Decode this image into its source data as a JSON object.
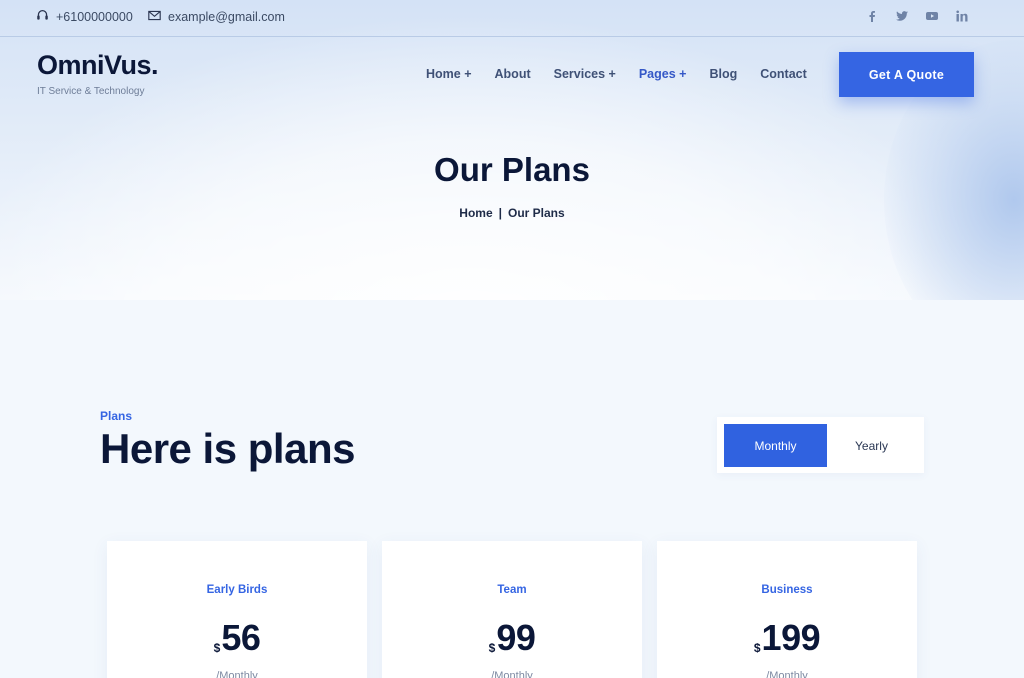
{
  "topbar": {
    "phone": "+6100000000",
    "email": "example@gmail.com",
    "socials": [
      "facebook-icon",
      "twitter-icon",
      "youtube-icon",
      "linkedin-icon"
    ]
  },
  "header": {
    "logo": "OmniVus.",
    "tagline": "IT Service & Technology",
    "nav": [
      "Home +",
      "About",
      "Services +",
      "Pages +",
      "Blog",
      "Contact"
    ],
    "active_nav": "Pages +",
    "cta": "Get A Quote"
  },
  "hero": {
    "title": "Our Plans",
    "breadcrumb_home": "Home",
    "breadcrumb_sep": "|",
    "breadcrumb_current": "Our Plans"
  },
  "plans": {
    "eyebrow": "Plans",
    "heading": "Here is plans",
    "toggle": {
      "monthly": "Monthly",
      "yearly": "Yearly",
      "selected": "Monthly"
    },
    "cards": [
      {
        "name": "Early Birds",
        "currency": "$",
        "price": "56",
        "period": "/Monthly"
      },
      {
        "name": "Team",
        "currency": "$",
        "price": "99",
        "period": "/Monthly"
      },
      {
        "name": "Business",
        "currency": "$",
        "price": "199",
        "period": "/Monthly"
      }
    ]
  },
  "colors": {
    "accent": "#3565e3",
    "heading": "#0b1738",
    "background": "#f3f8fd"
  }
}
